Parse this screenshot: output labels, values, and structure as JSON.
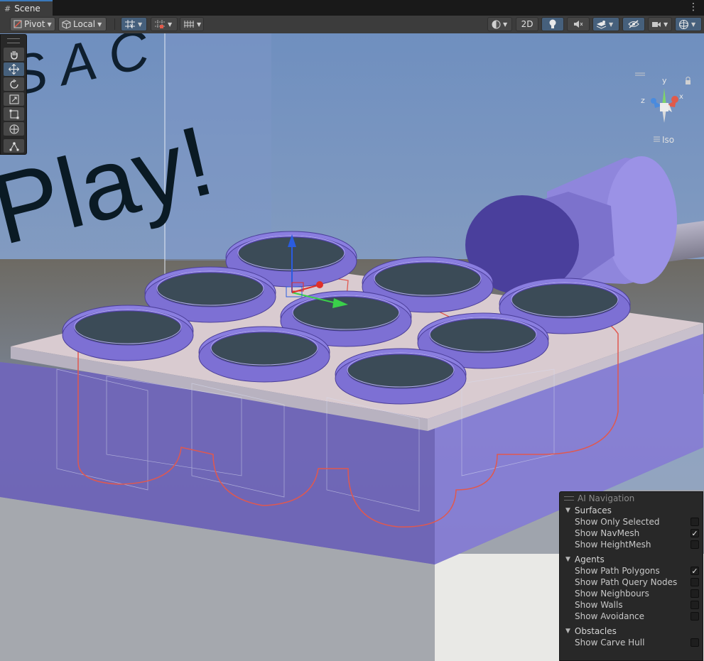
{
  "window": {
    "tab_label": "Scene",
    "tab_icon": "scene-grid-icon",
    "menu_icon": "kebab-menu-icon"
  },
  "toolbar": {
    "pivot_label": "Pivot",
    "local_label": "Local",
    "mode_2d_label": "2D"
  },
  "viewport": {
    "sign_text_top": "S A C",
    "sign_text_bottom": "Play!",
    "orientation_label": "Iso",
    "gizmo_axes": {
      "x": "x",
      "y": "y",
      "z": "z"
    }
  },
  "ai_navigation": {
    "title": "AI Navigation",
    "sections": [
      {
        "label": "Surfaces",
        "items": [
          {
            "label": "Show Only Selected",
            "checked": false
          },
          {
            "label": "Show NavMesh",
            "checked": true
          },
          {
            "label": "Show HeightMesh",
            "checked": false
          }
        ]
      },
      {
        "label": "Agents",
        "items": [
          {
            "label": "Show Path Polygons",
            "checked": true
          },
          {
            "label": "Show Path Query Nodes",
            "checked": false
          },
          {
            "label": "Show Neighbours",
            "checked": false
          },
          {
            "label": "Show Walls",
            "checked": false
          },
          {
            "label": "Show Avoidance",
            "checked": false
          }
        ]
      },
      {
        "label": "Obstacles",
        "items": [
          {
            "label": "Show Carve Hull",
            "checked": false
          }
        ]
      }
    ]
  },
  "colors": {
    "accent": "#3a79bb",
    "selected_tool": "#46607c",
    "object_purple": "#8b7ee0",
    "navmesh_outline": "#e0584f"
  }
}
